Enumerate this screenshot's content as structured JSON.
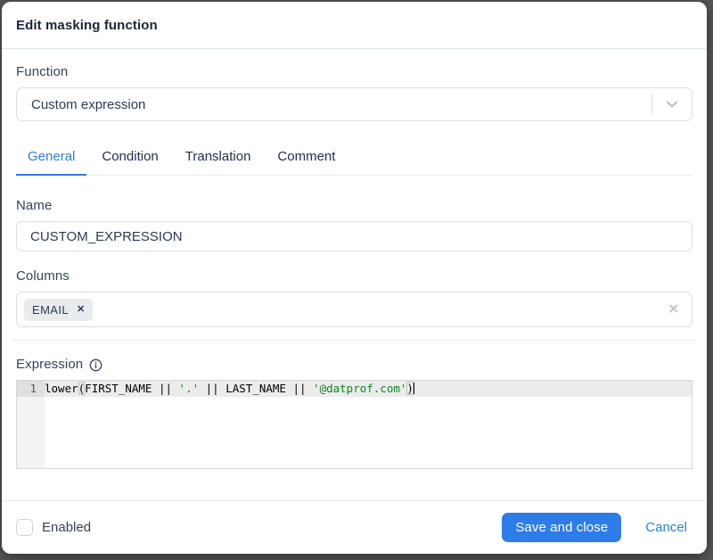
{
  "dialog": {
    "title": "Edit masking function",
    "function": {
      "label": "Function",
      "value": "Custom expression"
    },
    "tabs": [
      {
        "label": "General"
      },
      {
        "label": "Condition"
      },
      {
        "label": "Translation"
      },
      {
        "label": "Comment"
      }
    ],
    "active_tab": "General",
    "name": {
      "label": "Name",
      "value": "CUSTOM_EXPRESSION"
    },
    "columns": {
      "label": "Columns",
      "tags": [
        {
          "label": "EMAIL"
        }
      ]
    },
    "expression": {
      "label": "Expression",
      "line_number": "1",
      "segments": [
        {
          "text": "lower",
          "type": "plain"
        },
        {
          "text": "(",
          "type": "bracket"
        },
        {
          "text": "FIRST_NAME || ",
          "type": "plain"
        },
        {
          "text": "'.'",
          "type": "string"
        },
        {
          "text": " || LAST_NAME || ",
          "type": "plain"
        },
        {
          "text": "'@datprof.com'",
          "type": "string"
        },
        {
          "text": ")",
          "type": "bracket"
        }
      ]
    },
    "footer": {
      "enabled_label": "Enabled",
      "enabled_checked": false,
      "save_label": "Save and close",
      "cancel_label": "Cancel"
    },
    "icons": {
      "remove_tag": "✕",
      "clear_tags": "✕"
    },
    "colors": {
      "accent_blue": "#2e7ce8",
      "string_green": "#0e8420",
      "tag_background": "#e9ecef",
      "backdrop": "#57575a"
    }
  }
}
